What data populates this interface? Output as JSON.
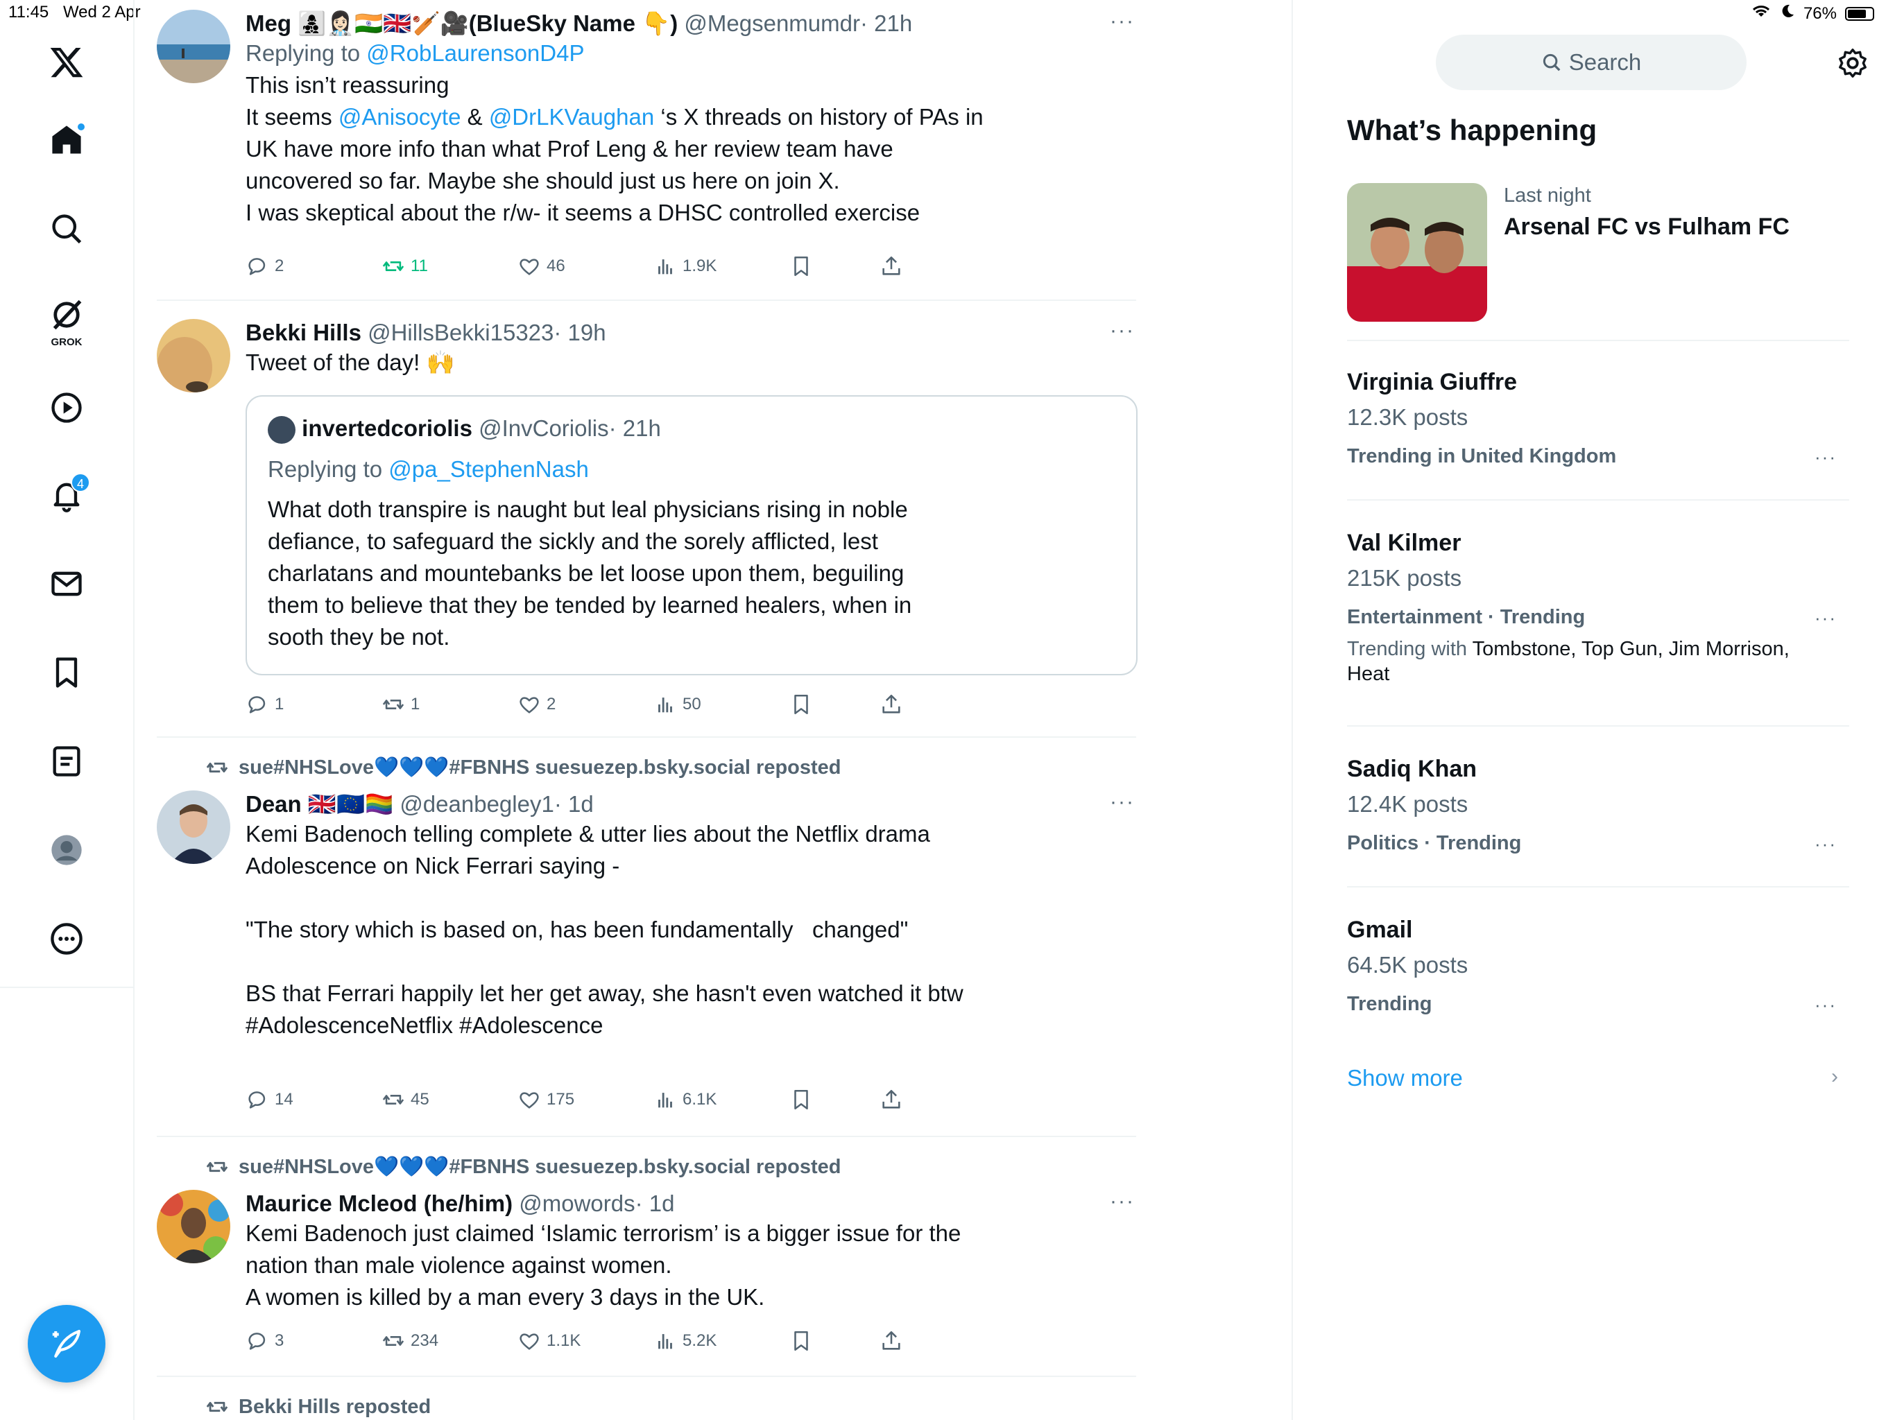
{
  "status_bar": {
    "time": "11:45",
    "date": "Wed 2 Apr",
    "battery": "76%",
    "battery_level": 0.76
  },
  "nav": {
    "grok_label": "GROK",
    "notifications_badge": "4"
  },
  "search": {
    "placeholder": "Search"
  },
  "trending": {
    "heading": "What’s happening",
    "event": {
      "subtitle": "Last night",
      "title": "Arsenal FC vs Fulham FC"
    },
    "items": [
      {
        "name": "Virginia Giuffre",
        "count": "12.3K posts",
        "context": "Trending in United Kingdom"
      },
      {
        "name": "Val Kilmer",
        "count": "215K posts",
        "context": "Entertainment · Trending",
        "with_label": "Trending with",
        "with_items": "Tombstone, Top Gun, Jim Morrison, Heat"
      },
      {
        "name": "Sadiq Khan",
        "count": "12.4K posts",
        "context": "Politics · Trending"
      },
      {
        "name": "Gmail",
        "count": "64.5K posts",
        "context": "Trending"
      }
    ],
    "show_more": "Show more"
  },
  "tweets": [
    {
      "name": "Meg 👩‍👧‍👦👩🏻‍⚕️🇮🇳🇬🇧🏏🎥(BlueSky Name 👇)",
      "handle": "@Megsenmumdr",
      "time": "· 21h",
      "reply_label": "Replying to",
      "reply_handle": "@RobLaurensonD4P",
      "line1": "This isn’t reassuring",
      "line2_a": "It seems",
      "mention1": "@Anisocyte",
      "line2_b": "&",
      "mention2": "@DrLKVaughan",
      "line2_c": "‘s X threads on history of PAs in",
      "rest": "UK have more info than what Prof Leng & her review team have\nuncovered so far. Maybe she should just us here on join X.\nI was skeptical about the r/w- it seems a DHSC controlled exercise",
      "replies": "2",
      "reposts": "11",
      "likes": "46",
      "views": "1.9K"
    },
    {
      "name": "Bekki Hills",
      "handle": "@HillsBekki15323",
      "time": "· 19h",
      "text": "Tweet of the day! 🙌",
      "quote": {
        "name": "invertedcoriolis",
        "handle": "@InvCoriolis",
        "time": "· 21h",
        "reply_label": "Replying to",
        "reply_handle": "@pa_StephenNash",
        "text": "What doth transpire is naught but leal physicians rising in noble\ndefiance, to safeguard the sickly and the sorely afflicted, lest\ncharlatans and mountebanks be let loose upon them, beguiling\nthem to believe that they be tended by learned healers, when in\nsooth they be not."
      },
      "replies": "1",
      "reposts": "1",
      "likes": "2",
      "views": "50"
    },
    {
      "repost_by": "sue#NHSLove💙💙💙#FBNHS suesuezep.bsky.social reposted",
      "name": "Dean 🇬🇧🇪🇺🏳️‍🌈",
      "handle": "@deanbegley1",
      "time": "· 1d",
      "text": "Kemi Badenoch telling complete & utter lies about the Netflix drama\nAdolescence on Nick Ferrari saying -\n\n\"The story which is based on, has been fundamentally   changed\"\n\nBS that Ferrari happily let her get away, she hasn't even watched it btw\n",
      "hashtags": "#AdolescenceNetflix #Adolescence",
      "replies": "14",
      "reposts": "45",
      "likes": "175",
      "views": "6.1K"
    },
    {
      "repost_by": "sue#NHSLove💙💙💙#FBNHS suesuezep.bsky.social reposted",
      "name": "Maurice Mcleod (he/him)",
      "handle": "@mowords",
      "time": "· 1d",
      "text": "Kemi Badenoch just claimed ‘Islamic terrorism’ is a bigger issue for the\nnation than male violence against women.\nA women is killed by a man every 3 days in the UK.",
      "replies": "3",
      "reposts": "234",
      "likes": "1.1K",
      "views": "5.2K"
    },
    {
      "repost_by": "Bekki Hills reposted"
    }
  ]
}
